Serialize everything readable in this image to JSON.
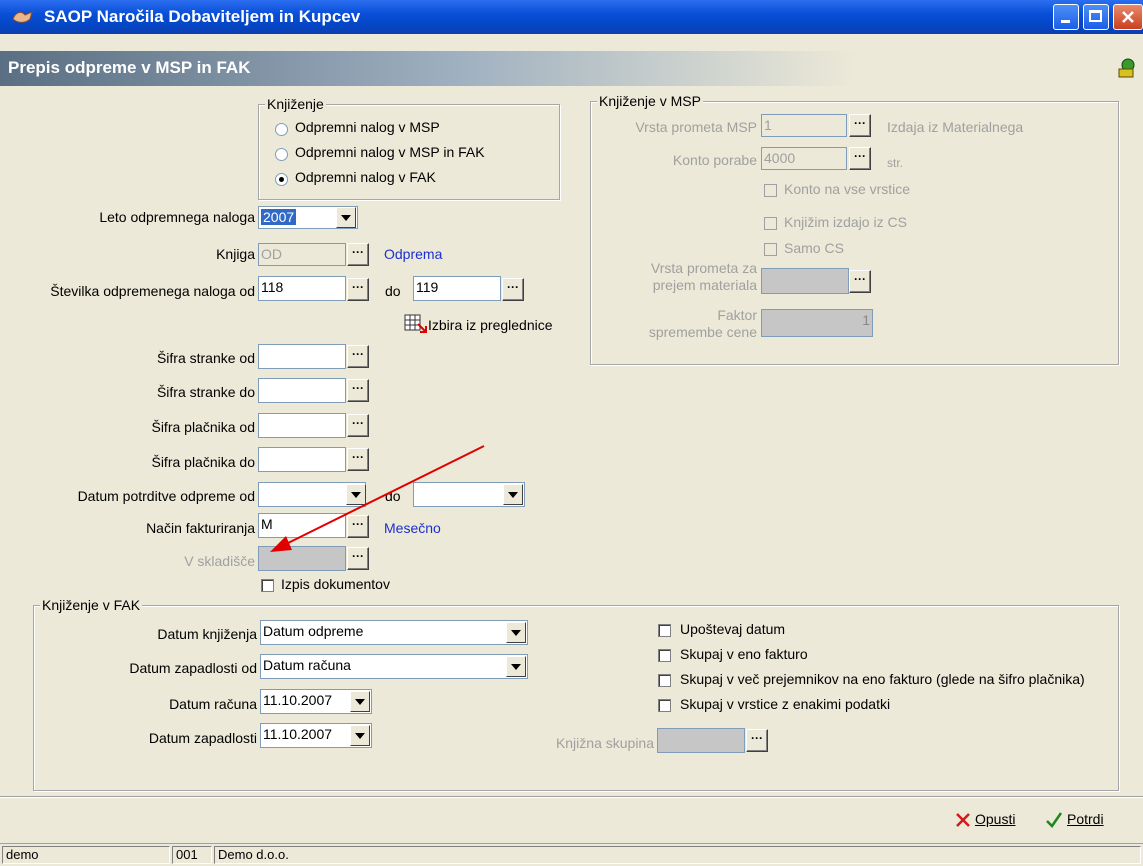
{
  "window": {
    "title": "SAOP  Naročila Dobaviteljem in Kupcev"
  },
  "header": {
    "title": "Prepis odpreme v MSP in FAK"
  },
  "knjizenje": {
    "legend": "Knjiženje",
    "options": [
      "Odpremni nalog v MSP",
      "Odpremni nalog v MSP in FAK",
      "Odpremni nalog v FAK"
    ],
    "selected_index": 2
  },
  "form": {
    "leto_label": "Leto odpremnega naloga",
    "leto_value": "2007",
    "knjiga_label": "Knjiga",
    "knjiga_value": "OD",
    "knjiga_desc": "Odprema",
    "stevilka_label": "Številka odpremenega naloga od",
    "stevilka_od": "118",
    "do_label": "do",
    "stevilka_do": "119",
    "izbira_label": "Izbira iz preglednice",
    "sifra_stranke_od_label": "Šifra stranke od",
    "sifra_stranke_do_label": "Šifra stranke do",
    "sifra_placnika_od_label": "Šifra plačnika od",
    "sifra_placnika_do_label": "Šifra plačnika do",
    "datum_potrditve_label": "Datum potrditve odpreme od",
    "datum_do_label": "do",
    "nacin_label": "Način fakturiranja",
    "nacin_value": "M",
    "nacin_desc": "Mesečno",
    "skladisce_label": "V skladišče",
    "izpis_label": "Izpis dokumentov"
  },
  "msp": {
    "legend": "Knjiženje v MSP",
    "vrsta_label": "Vrsta prometa MSP",
    "vrsta_value": "1",
    "vrsta_desc": "Izdaja iz Materialnega",
    "konto_label": "Konto porabe",
    "konto_value": "4000",
    "konto_desc": "str.",
    "chk1": "Konto na vse vrstice",
    "chk2": "Knjižim izdajo iz CS",
    "chk3": "Samo CS",
    "vrsta_prejem_label1": "Vrsta prometa za",
    "vrsta_prejem_label2": "prejem materiala",
    "faktor_label1": "Faktor",
    "faktor_label2": "spremembe cene",
    "faktor_value": "1"
  },
  "fak": {
    "legend": "Knjiženje v FAK",
    "datum_knjizenja_label": "Datum knjiženja",
    "datum_knjizenja_value": "Datum odpreme",
    "datum_zapadlosti_od_label": "Datum zapadlosti od",
    "datum_zapadlosti_od_value": "Datum računa",
    "datum_racuna_label": "Datum računa",
    "datum_racuna_value": "11.10.2007",
    "datum_zapadlosti_label": "Datum zapadlosti",
    "datum_zapadlosti_value": "11.10.2007",
    "chk_upostevaj": "Upoštevaj datum",
    "chk_skupaj_eno": "Skupaj v eno fakturo",
    "chk_skupaj_vec": "Skupaj v več prejemnikov na eno fakturo (glede na šifro plačnika)",
    "chk_skupaj_vrstice": "Skupaj v vrstice z enakimi podatki",
    "knjizna_label": "Knjižna skupina"
  },
  "buttons": {
    "opusti": "Opusti",
    "potrdi": "Potrdi"
  },
  "status": {
    "user": "demo",
    "code": "001",
    "company": "Demo d.o.o."
  },
  "colors": {
    "titlebar": "#0a4fd8",
    "link_blue": "#1a2fd1",
    "annotation_arrow": "#e00000",
    "confirm_green": "#1a8a1a",
    "cancel_red": "#d21a1a"
  }
}
